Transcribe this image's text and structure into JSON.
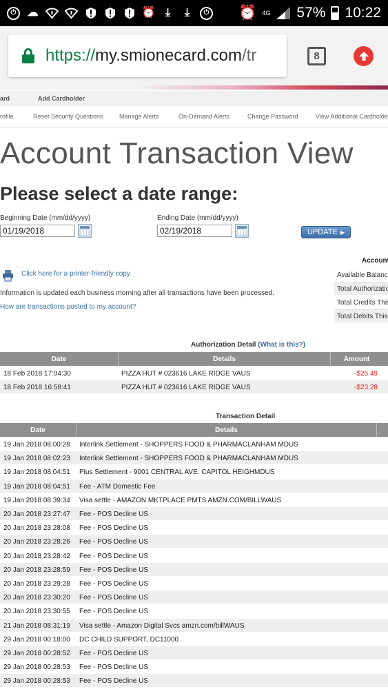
{
  "status_bar": {
    "left_icons": [
      "sync-icon",
      "weather-icon",
      "wifi-alert-icon",
      "wifi-alert-icon",
      "alert-icon",
      "alert-icon",
      "alert-icon",
      "alarm-icon",
      "download-icon",
      "download-icon",
      "sync-icon"
    ],
    "battery": "57%",
    "time": "10:22",
    "network": "4G"
  },
  "browser": {
    "url_scheme": "https://",
    "url_host": "my.smionecard.com",
    "url_path": "/tr",
    "tab_count": "8"
  },
  "nav": {
    "primary": [
      "ard",
      "Add Cardholder"
    ],
    "secondary": [
      "rofile",
      "Reset Security Questions",
      "Manage Alerts",
      "On-Demand Alerts",
      "Change Password",
      "View Additional Cardholders"
    ]
  },
  "page_title": "Account Transaction View",
  "section_title": "Please select a date range:",
  "date_range": {
    "begin_label": "Beginning Date (mm/dd/yyyy)",
    "begin_value": "01/19/2018",
    "end_label": "Ending Date (mm/dd/yyyy)",
    "end_value": "02/19/2018",
    "update_label": "UPDATE"
  },
  "printer_link": "Click here for a printer-friendly copy",
  "info_text": "Information is updated each business morning after all transactions have been processed.",
  "how_link": "How are transactions posted to my account?",
  "account_summary": {
    "title": "Account",
    "rows": [
      "Available Balance",
      "Total Authorizations",
      "Total Credits This",
      "Total Debits This"
    ]
  },
  "auth_detail": {
    "caption": "Authorization Detail",
    "caption_link": "(What is this?)",
    "headers": [
      "Date",
      "Details",
      "Amount"
    ],
    "rows": [
      {
        "date": "18 Feb 2018 17:04:30",
        "details": "PIZZA HUT # 023616 LAKE RIDGE VAUS",
        "amount": "-$25.49"
      },
      {
        "date": "18 Feb 2018 16:58:41",
        "details": "PIZZA HUT # 023616 LAKE RIDGE VAUS",
        "amount": "-$23.28"
      }
    ]
  },
  "txn_detail": {
    "caption": "Transaction Detail",
    "headers": [
      "Date",
      "Details"
    ],
    "rows": [
      {
        "date": "19 Jan 2018 08:00:28",
        "details": "Interlink Settlement - SHOPPERS FOOD & PHARMACLANHAM MDUS"
      },
      {
        "date": "19 Jan 2018 08:02:23",
        "details": "Interlink Settlement - SHOPPERS FOOD & PHARMACLANHAM MDUS"
      },
      {
        "date": "19 Jan 2018 08:04:51",
        "details": "Plus Settlement - 9001 CENTRAL AVE. CAPITOL HEIGHMDUS"
      },
      {
        "date": "19 Jan 2018 08:04:51",
        "details": "Fee - ATM Domestic Fee"
      },
      {
        "date": "19 Jan 2018 08:39:34",
        "details": "Visa settle - AMAZON MKTPLACE PMTS AMZN.COM/BILLWAUS"
      },
      {
        "date": "20 Jan 2018 23:27:47",
        "details": "Fee - POS Decline US"
      },
      {
        "date": "20 Jan 2018 23:28:08",
        "details": "Fee - POS Decline US"
      },
      {
        "date": "20 Jan 2018 23:28:26",
        "details": "Fee - POS Decline US"
      },
      {
        "date": "20 Jan 2018 23:28:42",
        "details": "Fee - POS Decline US"
      },
      {
        "date": "20 Jan 2018 23:28:59",
        "details": "Fee - POS Decline US"
      },
      {
        "date": "20 Jan 2018 23:29:28",
        "details": "Fee - POS Decline US"
      },
      {
        "date": "20 Jan 2018 23:30:20",
        "details": "Fee - POS Decline US"
      },
      {
        "date": "20 Jan 2018 23:30:55",
        "details": "Fee - POS Decline US"
      },
      {
        "date": "21 Jan 2018 08:31:19",
        "details": "Visa settle - Amazon Digital Svcs amzn.com/billWAUS"
      },
      {
        "date": "29 Jan 2018 00:18:00",
        "details": "DC CHILD SUPPORT, DC11000"
      },
      {
        "date": "29 Jan 2018 00:28:52",
        "details": "Fee - POS Decline US"
      },
      {
        "date": "29 Jan 2018 00:28:53",
        "details": "Fee - POS Decline US"
      },
      {
        "date": "29 Jan 2018 00:28:53",
        "details": "Fee - POS Decline US"
      }
    ]
  },
  "colors": {
    "link": "#3a6ea5",
    "negative_amount": "#e02020",
    "table_header": "#8f8f8f",
    "secure_green": "#0b8043"
  }
}
